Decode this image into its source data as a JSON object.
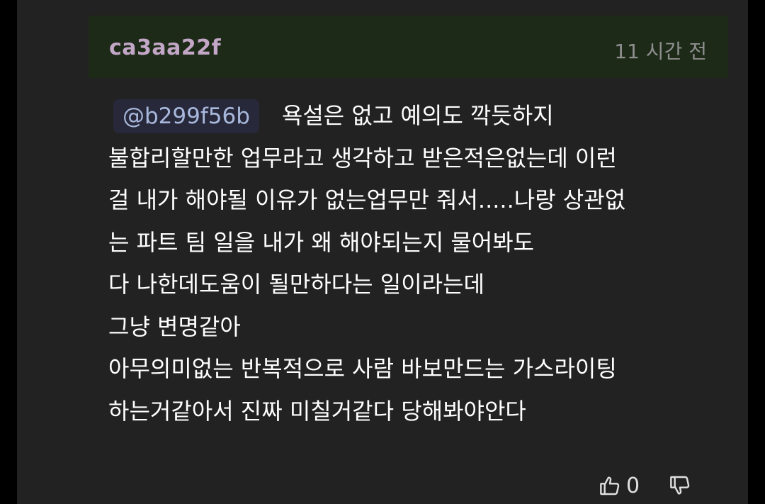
{
  "comment": {
    "author": "ca3aa22f",
    "timestamp": "11 시간 전",
    "mention": "@b299f56b",
    "lines": [
      "욕설은 없고 예의도 깍듯하지",
      "불합리할만한 업무라고 생각하고 받은적은없는데 이런",
      "걸 내가 해야될 이유가 없는업무만 줘서.....나랑 상관없",
      "는 파트 팀 일을 내가 왜 해야되는지 물어봐도",
      "다 나한데도움이 될만하다는 일이라는데",
      "그냥 변명같아",
      "아무의미없는 반복적으로 사람 바보만드는 가스라이팅",
      "하는거같아서 진짜 미칠거같다 당해봐야안다"
    ],
    "like_count": "0"
  },
  "icons": {
    "like": "thumbs-up-icon",
    "dislike": "thumbs-down-icon"
  },
  "colors": {
    "background": "#222222",
    "header": "#1d2a18",
    "author": "#c3a7c6",
    "mention_text": "#a8b8dc",
    "mention_bg": "#27293a"
  }
}
